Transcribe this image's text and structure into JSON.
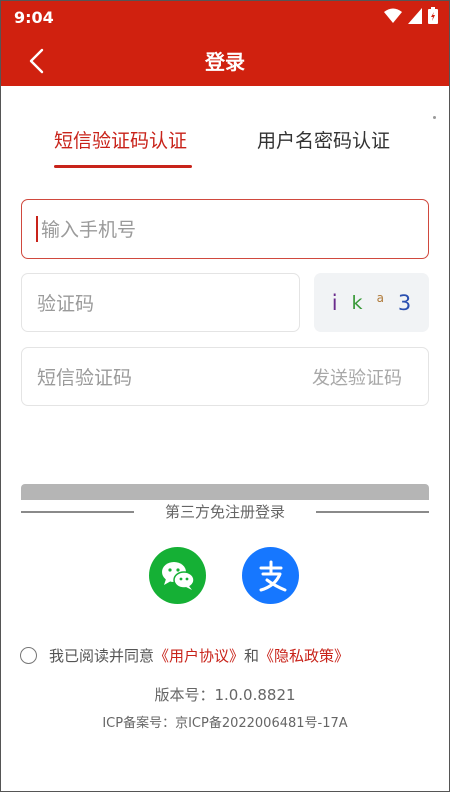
{
  "status_bar": {
    "time": "9:04"
  },
  "app_bar": {
    "title": "登录"
  },
  "tabs": [
    {
      "label": "短信验证码认证",
      "active": true
    },
    {
      "label": "用户名密码认证",
      "active": false
    }
  ],
  "form": {
    "phone_placeholder": "输入手机号",
    "verify_placeholder": "验证码",
    "captcha_chars": [
      "i",
      "k",
      "a",
      "3"
    ],
    "sms_placeholder": "短信验证码",
    "send_code_label": "发送验证码"
  },
  "third_party": {
    "label": "第三方免注册登录"
  },
  "agreement": {
    "prefix": "我已阅读并同意",
    "user_agreement": "《用户协议》",
    "and": "和",
    "privacy_policy": "《隐私政策》"
  },
  "footer": {
    "version": "版本号：1.0.0.8821",
    "icp": "ICP备案号：京ICP备2022006481号-17A"
  },
  "colors": {
    "primary": "#d0210f",
    "wechat": "#15b035",
    "alipay": "#1677ff"
  }
}
